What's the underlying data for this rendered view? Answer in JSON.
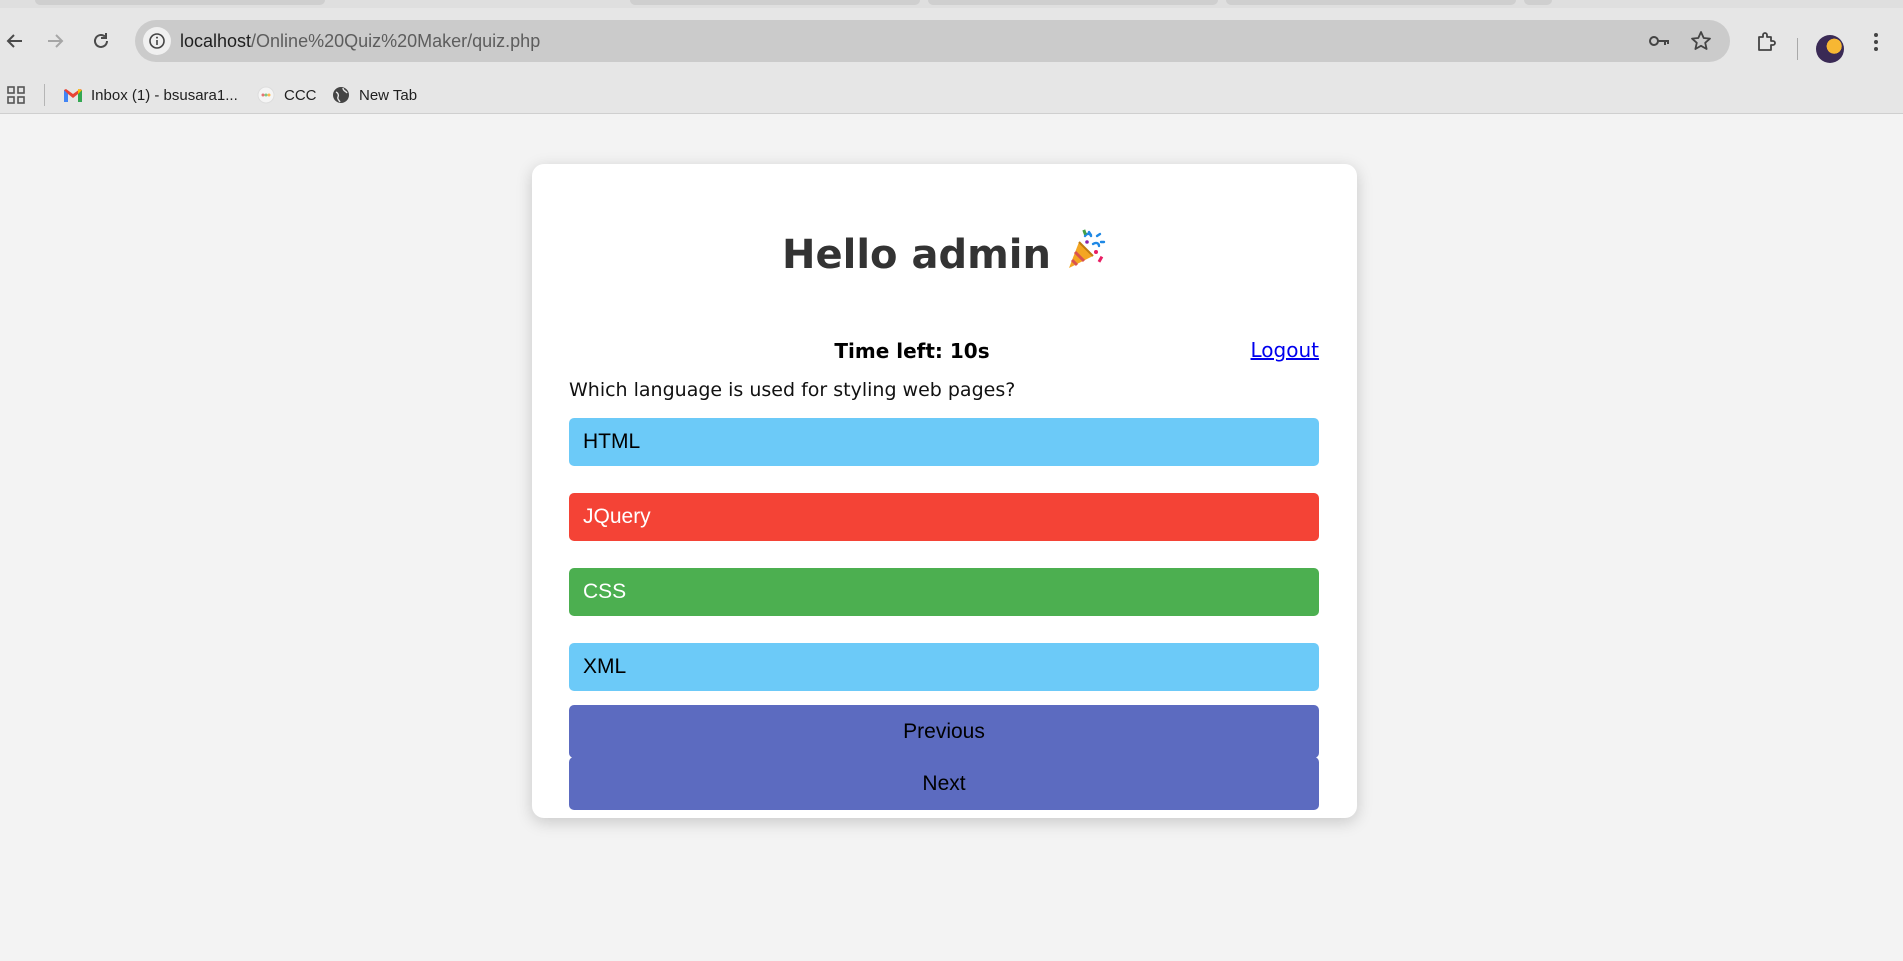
{
  "browser": {
    "url_host": "localhost",
    "url_path": "/Online%20Quiz%20Maker/quiz.php",
    "bookmarks": [
      {
        "label": "Inbox (1) - bsusara1...",
        "icon": "gmail-icon"
      },
      {
        "label": "CCC",
        "icon": "ccc-favicon"
      },
      {
        "label": "New Tab",
        "icon": "globe-icon"
      }
    ]
  },
  "quiz": {
    "greeting": "Hello admin",
    "greeting_emoji": "🎉",
    "timer": "Time left: 10s",
    "logout_label": "Logout",
    "question": "Which language is used for styling web pages?",
    "options": [
      {
        "label": "HTML",
        "state": "neutral",
        "color": "#6ccaf8",
        "text_color": "#000000"
      },
      {
        "label": "JQuery",
        "state": "incorrect",
        "color": "#f44336",
        "text_color": "#ffffff"
      },
      {
        "label": "CSS",
        "state": "correct",
        "color": "#4caf50",
        "text_color": "#ffffff"
      },
      {
        "label": "XML",
        "state": "neutral",
        "color": "#6ccaf8",
        "text_color": "#000000"
      }
    ],
    "previous_label": "Previous",
    "next_label": "Next"
  },
  "colors": {
    "nav_button": "#5c6bc0",
    "page_bg": "#f3f3f3",
    "card_bg": "#ffffff"
  }
}
